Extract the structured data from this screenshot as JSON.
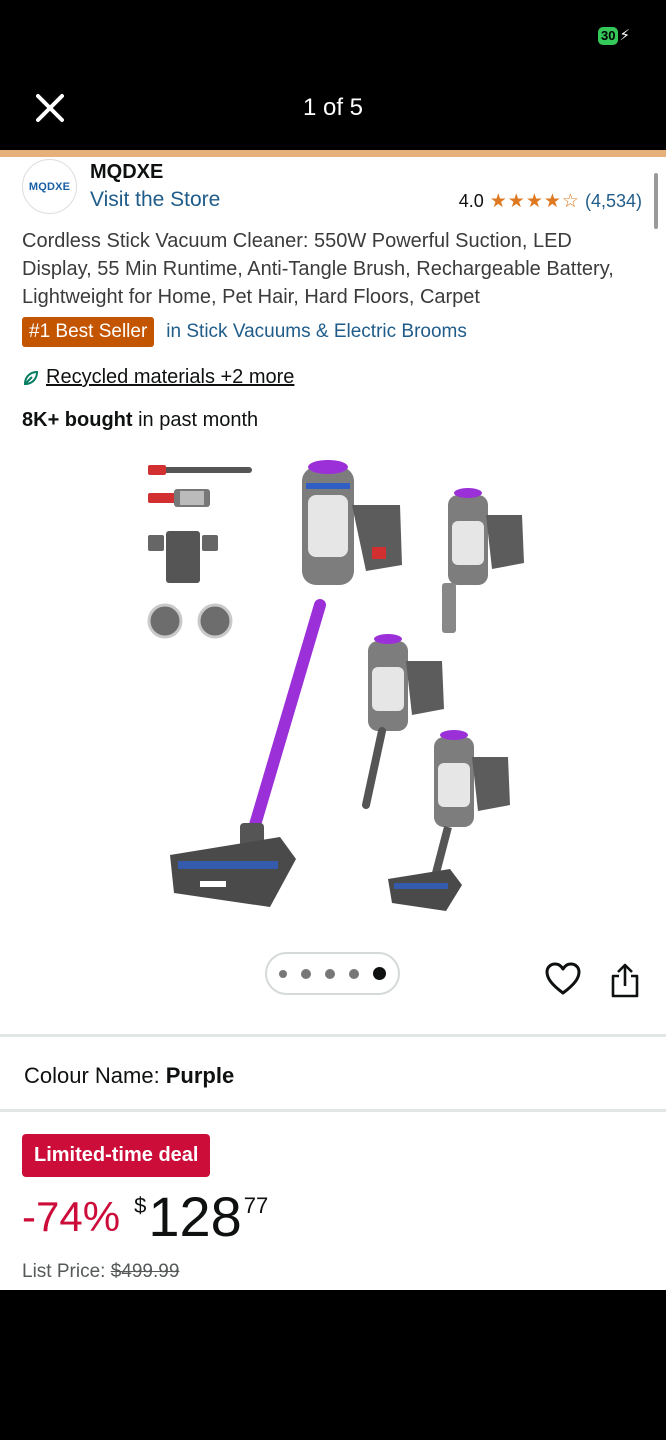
{
  "status_bar": {
    "battery": "30"
  },
  "viewer": {
    "pager": "1 of 5"
  },
  "store": {
    "logo_text": "MQDXE",
    "brand": "MQDXE",
    "visit_link": "Visit the Store",
    "rating": "4.0",
    "stars": 4,
    "review_count": "(4,534)"
  },
  "product": {
    "title": "Cordless Stick Vacuum Cleaner: 550W Powerful Suction, LED Display, 55 Min Runtime, Anti-Tangle Brush, Rechargeable Battery, Lightweight for Home, Pet Hair, Hard Floors, Carpet",
    "best_seller_badge": "#1 Best Seller",
    "category_link": "in Stick Vacuums & Electric Brooms",
    "sustainability": "Recycled materials +2 more",
    "bought_bold": "8K+ bought",
    "bought_rest": " in past month"
  },
  "gallery": {
    "total_dots": 5,
    "active_dot": 5
  },
  "colour": {
    "label": "Colour Name:",
    "value": "Purple"
  },
  "pricing": {
    "deal_label": "Limited-time deal",
    "discount": "-74%",
    "currency": "$",
    "whole": "128",
    "fraction": "77",
    "list_label": "List Price:",
    "list_value": "$499.99"
  },
  "colors": {
    "accent": "#e7b07a",
    "star": "#de7921",
    "deal": "#cc0c39",
    "best_seller": "#c45500",
    "link": "#1f5c8a",
    "vacuum": "#9b30d9"
  }
}
